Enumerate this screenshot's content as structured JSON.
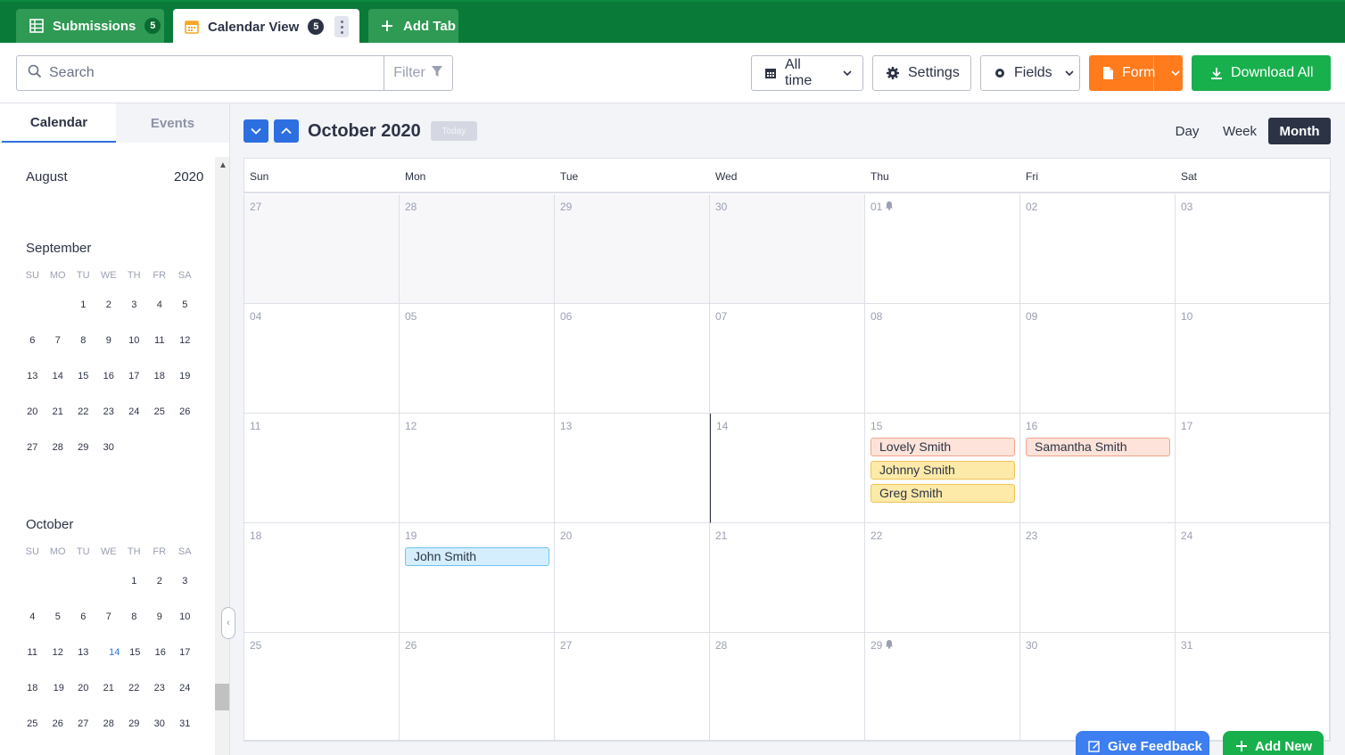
{
  "tabs": {
    "submissions": {
      "label": "Submissions",
      "count": "5"
    },
    "calendar_view": {
      "label": "Calendar View",
      "count": "5"
    },
    "add_tab": {
      "label": "Add Tab"
    }
  },
  "toolbar": {
    "search_placeholder": "Search",
    "filter_label": "Filter",
    "alltime_label": "All time",
    "settings_label": "Settings",
    "fields_label": "Fields",
    "form_label": "Form",
    "download_label": "Download All"
  },
  "sidebar": {
    "tab_calendar": "Calendar",
    "tab_events": "Events",
    "weekday_labels": [
      "SU",
      "MO",
      "TU",
      "WE",
      "TH",
      "FR",
      "SA"
    ],
    "months": [
      {
        "name": "August",
        "year": "2020",
        "weeks": []
      },
      {
        "name": "September",
        "year": "",
        "weeks": [
          [
            "",
            "",
            "1",
            "2",
            "3",
            "4",
            "5"
          ],
          [
            "6",
            "7",
            "8",
            "9",
            "10",
            "11",
            "12"
          ],
          [
            "13",
            "14",
            "15",
            "16",
            "17",
            "18",
            "19"
          ],
          [
            "20",
            "21",
            "22",
            "23",
            "24",
            "25",
            "26"
          ],
          [
            "27",
            "28",
            "29",
            "30",
            "",
            "",
            ""
          ]
        ]
      },
      {
        "name": "October",
        "year": "",
        "weeks": [
          [
            "",
            "",
            "",
            "",
            "1",
            "2",
            "3"
          ],
          [
            "4",
            "5",
            "6",
            "7",
            "8",
            "9",
            "10"
          ],
          [
            "11",
            "12",
            "13",
            "14",
            "15",
            "16",
            "17"
          ],
          [
            "18",
            "19",
            "20",
            "21",
            "22",
            "23",
            "24"
          ],
          [
            "25",
            "26",
            "27",
            "28",
            "29",
            "30",
            "31"
          ]
        ]
      }
    ],
    "selected_day": "14",
    "days_with_events": [
      "15",
      "16",
      "19"
    ]
  },
  "calendar": {
    "title": "October 2020",
    "today_label": "Today",
    "views": {
      "day": "Day",
      "week": "Week",
      "month": "Month"
    },
    "active_view": "Month",
    "weekday_headers": [
      "Sun",
      "Mon",
      "Tue",
      "Wed",
      "Thu",
      "Fri",
      "Sat"
    ],
    "weeks": [
      [
        {
          "d": "27",
          "out": true
        },
        {
          "d": "28",
          "out": true
        },
        {
          "d": "29",
          "out": true
        },
        {
          "d": "30",
          "out": true
        },
        {
          "d": "01",
          "bell": true
        },
        {
          "d": "02"
        },
        {
          "d": "03"
        }
      ],
      [
        {
          "d": "04"
        },
        {
          "d": "05"
        },
        {
          "d": "06"
        },
        {
          "d": "07"
        },
        {
          "d": "08"
        },
        {
          "d": "09"
        },
        {
          "d": "10"
        }
      ],
      [
        {
          "d": "11"
        },
        {
          "d": "12"
        },
        {
          "d": "13"
        },
        {
          "d": "14",
          "today": true
        },
        {
          "d": "15",
          "events": [
            {
              "name": "Lovely Smith",
              "color": "salmon"
            },
            {
              "name": "Johnny Smith",
              "color": "yellow"
            },
            {
              "name": "Greg Smith",
              "color": "yellow"
            }
          ]
        },
        {
          "d": "16",
          "events": [
            {
              "name": "Samantha Smith",
              "color": "salmon"
            }
          ]
        },
        {
          "d": "17"
        }
      ],
      [
        {
          "d": "18"
        },
        {
          "d": "19",
          "events": [
            {
              "name": "John Smith",
              "color": "blue"
            }
          ]
        },
        {
          "d": "20"
        },
        {
          "d": "21"
        },
        {
          "d": "22"
        },
        {
          "d": "23"
        },
        {
          "d": "24"
        }
      ],
      [
        {
          "d": "25"
        },
        {
          "d": "26"
        },
        {
          "d": "27"
        },
        {
          "d": "28"
        },
        {
          "d": "29",
          "bell": true
        },
        {
          "d": "30"
        },
        {
          "d": "31"
        }
      ]
    ]
  },
  "footer": {
    "feedback_label": "Give Feedback",
    "add_new_label": "Add New"
  },
  "colors": {
    "header_green": "#0a7a39",
    "tab_green": "#2e9a54",
    "accent_blue": "#2d6fe0",
    "form_orange": "#ff7b1c",
    "download_green": "#18b04d",
    "dark": "#2c3345"
  }
}
